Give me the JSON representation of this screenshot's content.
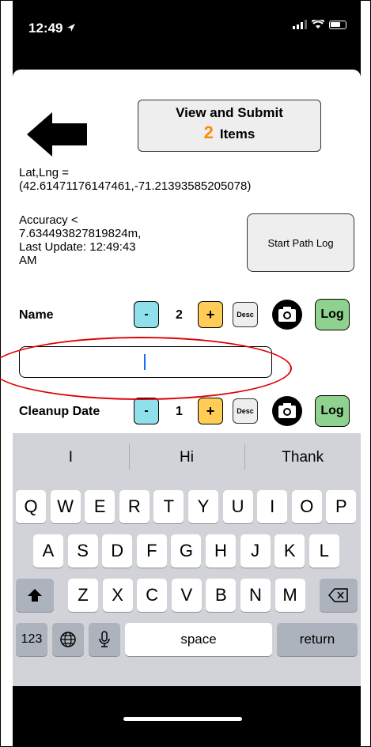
{
  "status": {
    "time": "12:49",
    "location_icon": "location-arrow-icon",
    "signal_icon": "signal-icon",
    "wifi_icon": "wifi-icon",
    "battery_icon": "battery-icon"
  },
  "header": {
    "back_icon": "left-arrow-icon",
    "submit_title": "View and Submit",
    "submit_count": "2",
    "submit_suffix": "Items"
  },
  "location": {
    "latlng_label": "Lat,Lng =",
    "latlng_value": "(42.61471176147461,-71.21393585205078)",
    "accuracy_line1": "Accuracy <",
    "accuracy_line2": "7.634493827819824m,",
    "accuracy_line3": "Last Update: 12:49:43",
    "accuracy_line4": "AM",
    "path_button": "Start Path Log"
  },
  "fields": [
    {
      "label": "Name",
      "minus": "-",
      "count": "2",
      "plus": "+",
      "desc": "Desc",
      "log": "Log"
    },
    {
      "label": "Cleanup Date",
      "minus": "-",
      "count": "1",
      "plus": "+",
      "desc": "Desc",
      "log": "Log"
    }
  ],
  "input": {
    "value": ""
  },
  "keyboard": {
    "suggestions": [
      "I",
      "Hi",
      "Thank"
    ],
    "row1": [
      "Q",
      "W",
      "E",
      "R",
      "T",
      "Y",
      "U",
      "I",
      "O",
      "P"
    ],
    "row2": [
      "A",
      "S",
      "D",
      "F",
      "G",
      "H",
      "J",
      "K",
      "L"
    ],
    "row3": [
      "Z",
      "X",
      "C",
      "V",
      "B",
      "N",
      "M"
    ],
    "shift_icon": "shift-icon",
    "backspace_icon": "backspace-icon",
    "numbers": "123",
    "globe_icon": "globe-icon",
    "mic_icon": "microphone-icon",
    "space": "space",
    "return": "return"
  },
  "annotation": {
    "color": "#e00000"
  }
}
